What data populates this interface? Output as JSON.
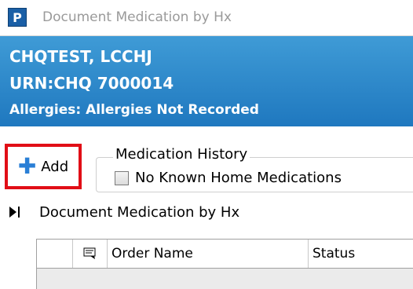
{
  "window": {
    "icon_letter": "P",
    "title": "Document Medication by Hx"
  },
  "patient": {
    "name": "CHQTEST, LCCHJ",
    "urn": "URN:CHQ 7000014",
    "allergies": "Allergies: Allergies Not Recorded"
  },
  "toolbar": {
    "add_label": "Add",
    "add_icon": "plus-icon"
  },
  "medication_history": {
    "group_title": "Medication History",
    "no_known_label": "No Known Home Medications",
    "no_known_checked": false
  },
  "section": {
    "title": "Document Medication by Hx"
  },
  "grid": {
    "columns": [
      "",
      "",
      "Order Name",
      "Status"
    ]
  },
  "colors": {
    "banner": "#2a86cc",
    "highlight_border": "#e10e16",
    "plus_icon": "#2a7fd6"
  }
}
